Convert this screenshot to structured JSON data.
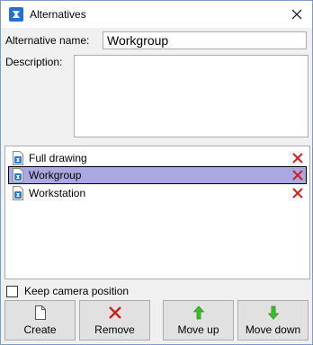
{
  "window": {
    "title": "Alternatives",
    "app_icon": "app-logo-icon",
    "close_icon": "close-icon"
  },
  "form": {
    "name_label": "Alternative name:",
    "name_value": "Workgroup",
    "description_label": "Description:",
    "description_value": ""
  },
  "alternatives": {
    "items": [
      {
        "label": "Full drawing",
        "selected": false
      },
      {
        "label": "Workgroup",
        "selected": true
      },
      {
        "label": "Workstation",
        "selected": false
      }
    ],
    "item_icon": "drawing-document-icon",
    "delete_icon": "delete-x-icon"
  },
  "options": {
    "keep_camera_label": "Keep camera position",
    "keep_camera_checked": false
  },
  "buttons": {
    "create": "Create",
    "remove": "Remove",
    "move_up": "Move up",
    "move_down": "Move down"
  },
  "colors": {
    "selection": "#aaa8e0",
    "delete_red": "#cc2222",
    "arrow_green": "#3bbf2c",
    "icon_blue": "#3a78c6"
  }
}
